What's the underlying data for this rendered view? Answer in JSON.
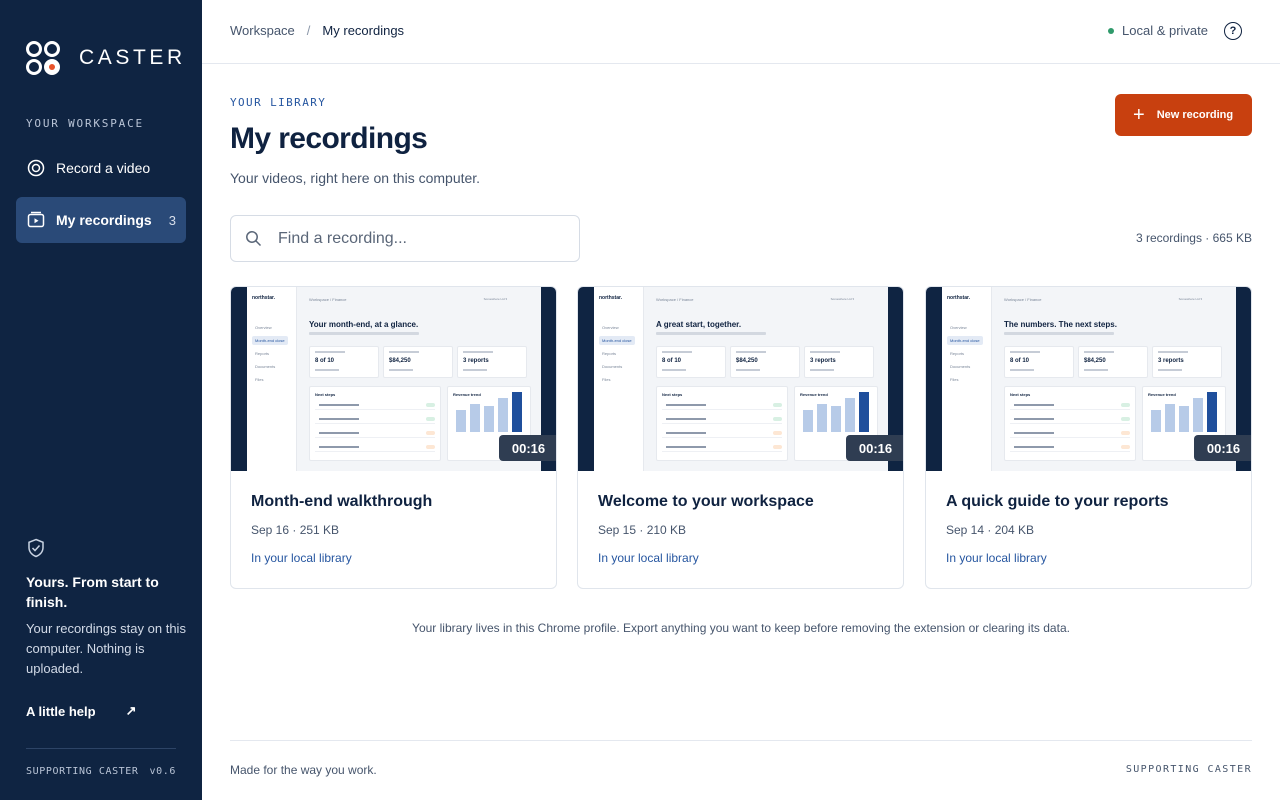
{
  "brand": {
    "name": "CASTER"
  },
  "sidebar": {
    "section_label": "YOUR WORKSPACE",
    "items": [
      {
        "label": "Record a video",
        "icon": "record-icon"
      },
      {
        "label": "My recordings",
        "icon": "recordings-icon",
        "count": "3",
        "active": true
      }
    ],
    "privacy_heading": "Yours. From start to finish.",
    "privacy_text": "Your recordings stay on this computer. Nothing is uploaded.",
    "help_link": "A little help",
    "footer_label": "SUPPORTING CASTER",
    "version": "v0.6"
  },
  "topbar": {
    "breadcrumb": [
      "Workspace",
      "My recordings"
    ],
    "status": "Local & private",
    "help_icon": "?"
  },
  "main": {
    "eyebrow": "YOUR LIBRARY",
    "title": "My recordings",
    "subtitle": "Your videos, right here on this computer.",
    "new_button": "New recording",
    "search_placeholder": "Find a recording...",
    "summary": "3 recordings · 665 KB",
    "note": "Your library lives in this Chrome profile. Export anything you want to keep before removing the extension or clearing its data."
  },
  "recordings": [
    {
      "title": "Month-end walkthrough",
      "meta": "Sep 16 · 251 KB",
      "location": "In your local library",
      "duration": "00:16",
      "thumb_heading": "Your month-end, at a glance."
    },
    {
      "title": "Welcome to your workspace",
      "meta": "Sep 15 · 210 KB",
      "location": "In your local library",
      "duration": "00:16",
      "thumb_heading": "A great start, together."
    },
    {
      "title": "A quick guide to your reports",
      "meta": "Sep 14 · 204 KB",
      "location": "In your local library",
      "duration": "00:16",
      "thumb_heading": "The numbers. The next steps."
    }
  ],
  "thumb_common": {
    "brand": "northstar.",
    "nav": [
      "Overview",
      "Month-end close",
      "Reports",
      "Documents",
      "Files"
    ],
    "crumb": "Workspace / Finance",
    "top_right": "Somewhere Ltd ▾",
    "kpis": [
      "8 of 10",
      "$84,250",
      "3 reports"
    ],
    "panel_left": "Next steps",
    "panel_right": "Revenue trend"
  },
  "footer": {
    "left": "Made for the way you work.",
    "right": "SUPPORTING CASTER"
  },
  "colors": {
    "sidebar_bg": "#0f2442",
    "accent": "#c8400f",
    "link": "#2656a0",
    "status_dot": "#2f9a6b"
  }
}
